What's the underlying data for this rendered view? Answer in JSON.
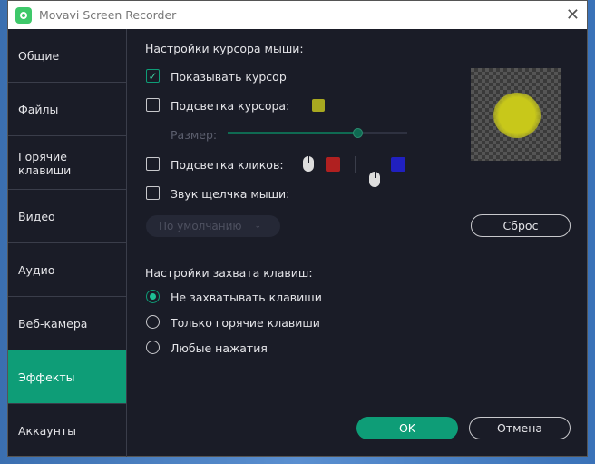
{
  "window": {
    "title": "Movavi Screen Recorder"
  },
  "sidebar": {
    "items": [
      {
        "label": "Общие"
      },
      {
        "label": "Файлы"
      },
      {
        "label": "Горячие клавиши"
      },
      {
        "label": "Видео"
      },
      {
        "label": "Аудио"
      },
      {
        "label": "Веб-камера"
      },
      {
        "label": "Эффекты",
        "active": true
      },
      {
        "label": "Аккаунты"
      }
    ]
  },
  "cursor": {
    "heading": "Настройки курсора мыши:",
    "show_cursor": "Показывать курсор",
    "show_cursor_checked": true,
    "highlight": "Подсветка курсора:",
    "highlight_checked": false,
    "highlight_color": "#a8a820",
    "size_label": "Размер:",
    "size_value": 0.72,
    "clicks": "Подсветка кликов:",
    "clicks_checked": false,
    "left_click_color": "#b02020",
    "right_click_color": "#2020c0",
    "sound": "Звук щелчка мыши:",
    "sound_checked": false,
    "sound_select": "По умолчанию",
    "reset": "Сброс"
  },
  "keys": {
    "heading": "Настройки захвата клавиш:",
    "options": [
      {
        "label": "Не захватывать клавиши",
        "selected": true
      },
      {
        "label": "Только горячие клавиши",
        "selected": false
      },
      {
        "label": "Любые нажатия",
        "selected": false
      }
    ]
  },
  "footer": {
    "ok": "OK",
    "cancel": "Отмена"
  },
  "colors": {
    "accent": "#0e9d77",
    "bg": "#1a1c27"
  }
}
